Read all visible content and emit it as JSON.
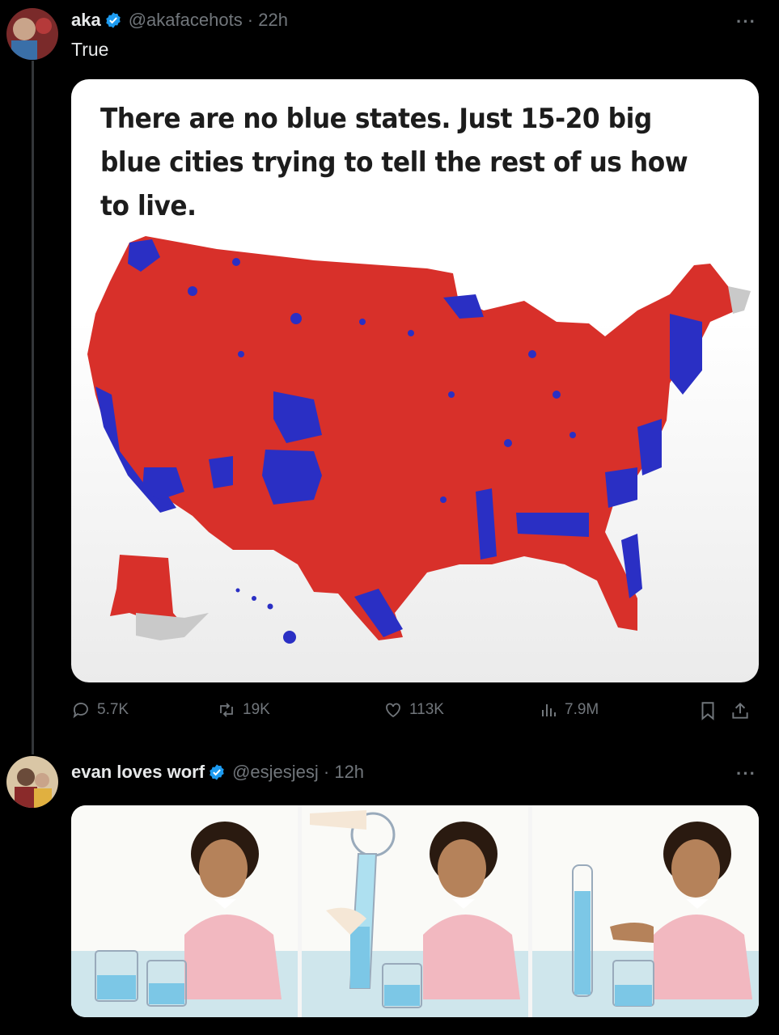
{
  "post1": {
    "display_name": "aka",
    "handle": "@akafacehots · 22h",
    "text": "True",
    "more": "···",
    "image_caption": "There are no blue states. Just 15-20 big blue cities trying to tell the rest of us how to live.",
    "metrics": {
      "replies": "5.7K",
      "reposts": "19K",
      "likes": "113K",
      "views": "7.9M"
    }
  },
  "post2": {
    "display_name": "evan loves worf",
    "handle": "@esjesjesj · 12h",
    "more": "···"
  },
  "colors": {
    "background": "#000000",
    "text_primary": "#e7e9ea",
    "text_secondary": "#71767b",
    "verified": "#1d9bf0",
    "map_red": "#d8302a",
    "map_blue": "#2a2fc4"
  },
  "icons": [
    "verified-badge-icon",
    "reply-icon",
    "repost-icon",
    "like-icon",
    "views-icon",
    "bookmark-icon",
    "share-icon",
    "more-icon"
  ]
}
